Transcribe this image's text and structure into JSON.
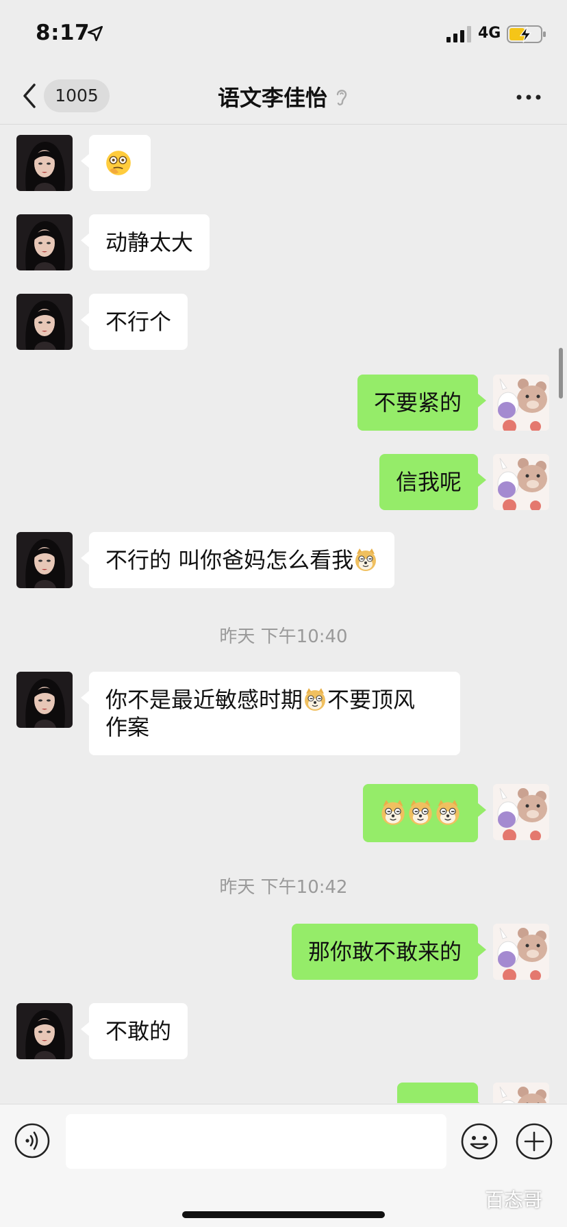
{
  "status_bar": {
    "time": "8:17",
    "network": "4G"
  },
  "header": {
    "back_count": "1005",
    "title": "语文李佳怡"
  },
  "messages": [
    {
      "side": "in",
      "text": "",
      "emoji": "thinking-face"
    },
    {
      "side": "in",
      "text": "动静太大"
    },
    {
      "side": "in",
      "text": "不行个"
    },
    {
      "side": "out",
      "text": "不要紧的"
    },
    {
      "side": "out",
      "text": "信我呢"
    },
    {
      "side": "in",
      "text": "不行的 叫你爸妈怎么看我"
    },
    {
      "side": "time",
      "text": "昨天 下午10:40"
    },
    {
      "side": "in",
      "text_line1": "你不是最近敏感时期",
      "text_line1b": "不要顶风",
      "text_line2": "作案"
    },
    {
      "side": "out",
      "text": "",
      "emoji": "doge x3"
    },
    {
      "side": "time",
      "text": "昨天 下午10:42"
    },
    {
      "side": "out",
      "text": "那你敢不敢来的"
    },
    {
      "side": "in",
      "text": "不敢的"
    },
    {
      "side": "out",
      "text": "",
      "note": "partially visible bubble"
    }
  ],
  "input_bar": {
    "text_value": ""
  },
  "watermark": "百态哥",
  "colors": {
    "background": "#ededed",
    "outgoing_bubble": "#95ec69",
    "incoming_bubble": "#ffffff",
    "timestamp": "#9a9a9a"
  }
}
